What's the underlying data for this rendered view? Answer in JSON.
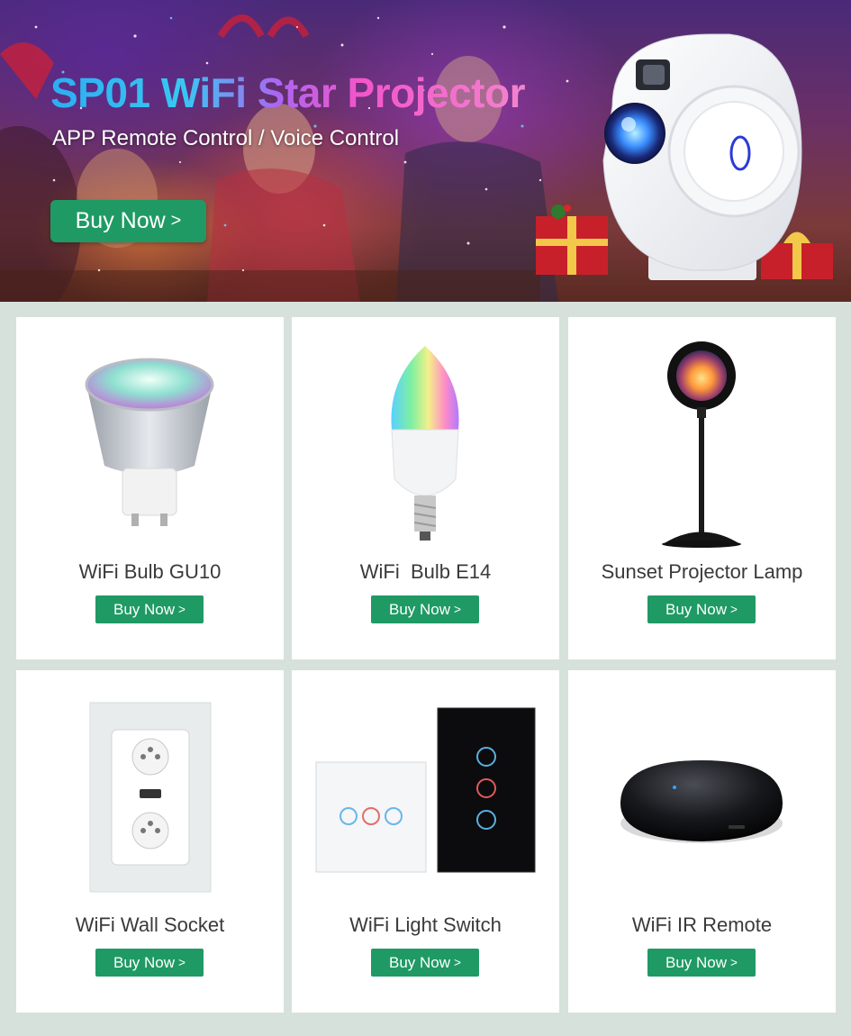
{
  "banner": {
    "title": "SP01 WiFi Star Projector",
    "subtitle": "APP Remote Control / Voice Control",
    "button_label": "Buy Now",
    "button_chevron": ">"
  },
  "products": [
    {
      "name": "WiFi Bulb GU10",
      "button_label": "Buy Now",
      "chevron": ">"
    },
    {
      "name": "WiFi  Bulb E14",
      "button_label": "Buy Now",
      "chevron": ">"
    },
    {
      "name": "Sunset Projector Lamp",
      "button_label": "Buy Now",
      "chevron": ">"
    },
    {
      "name": "WiFi Wall Socket",
      "button_label": "Buy Now",
      "chevron": ">"
    },
    {
      "name": "WiFi Light Switch",
      "button_label": "Buy Now",
      "chevron": ">"
    },
    {
      "name": "WiFi IR Remote",
      "button_label": "Buy Now",
      "chevron": ">"
    }
  ],
  "colors": {
    "accent_green": "#1f9a64",
    "page_background": "#d7e1dc",
    "card_background": "#ffffff"
  },
  "icons": [
    "star-projector-image",
    "gu10-bulb-image",
    "e14-bulb-image",
    "sunset-lamp-image",
    "wall-socket-image",
    "light-switch-image",
    "ir-remote-image"
  ]
}
